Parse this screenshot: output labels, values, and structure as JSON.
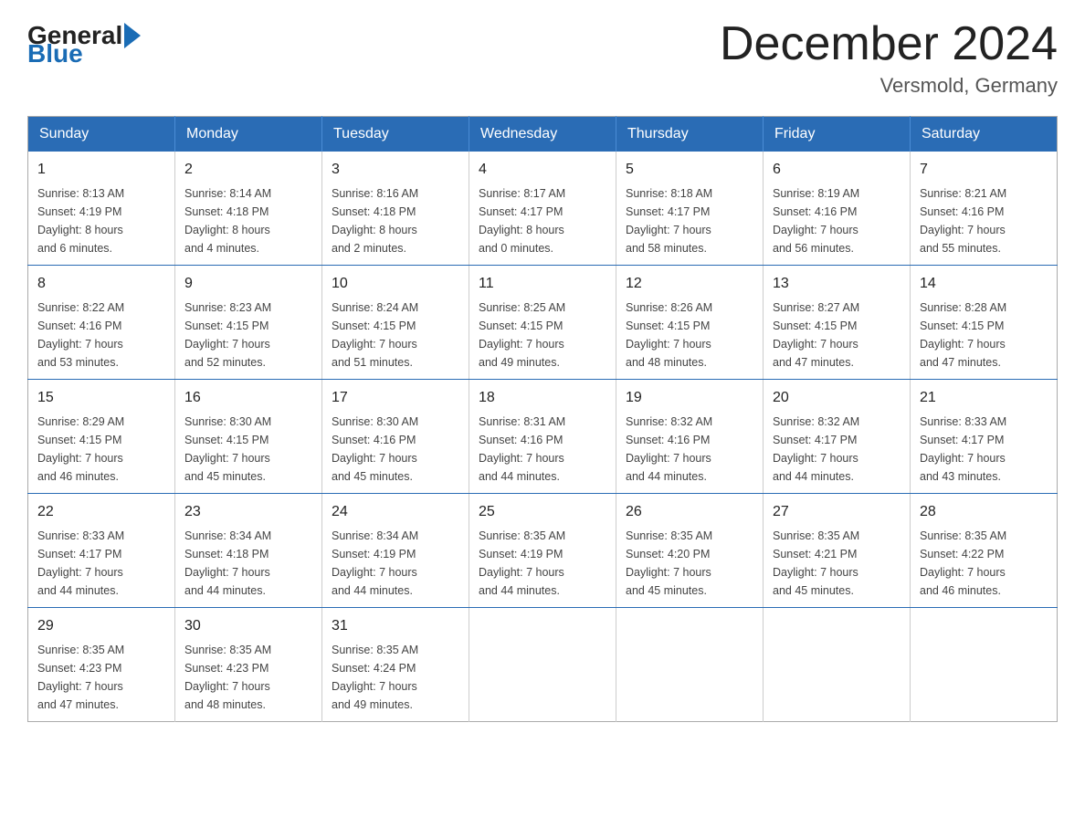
{
  "logo": {
    "general": "General",
    "blue": "Blue"
  },
  "header": {
    "month": "December 2024",
    "location": "Versmold, Germany"
  },
  "days_of_week": [
    "Sunday",
    "Monday",
    "Tuesday",
    "Wednesday",
    "Thursday",
    "Friday",
    "Saturday"
  ],
  "weeks": [
    [
      {
        "day": "1",
        "sunrise": "Sunrise: 8:13 AM",
        "sunset": "Sunset: 4:19 PM",
        "daylight": "Daylight: 8 hours and 6 minutes."
      },
      {
        "day": "2",
        "sunrise": "Sunrise: 8:14 AM",
        "sunset": "Sunset: 4:18 PM",
        "daylight": "Daylight: 8 hours and 4 minutes."
      },
      {
        "day": "3",
        "sunrise": "Sunrise: 8:16 AM",
        "sunset": "Sunset: 4:18 PM",
        "daylight": "Daylight: 8 hours and 2 minutes."
      },
      {
        "day": "4",
        "sunrise": "Sunrise: 8:17 AM",
        "sunset": "Sunset: 4:17 PM",
        "daylight": "Daylight: 8 hours and 0 minutes."
      },
      {
        "day": "5",
        "sunrise": "Sunrise: 8:18 AM",
        "sunset": "Sunset: 4:17 PM",
        "daylight": "Daylight: 7 hours and 58 minutes."
      },
      {
        "day": "6",
        "sunrise": "Sunrise: 8:19 AM",
        "sunset": "Sunset: 4:16 PM",
        "daylight": "Daylight: 7 hours and 56 minutes."
      },
      {
        "day": "7",
        "sunrise": "Sunrise: 8:21 AM",
        "sunset": "Sunset: 4:16 PM",
        "daylight": "Daylight: 7 hours and 55 minutes."
      }
    ],
    [
      {
        "day": "8",
        "sunrise": "Sunrise: 8:22 AM",
        "sunset": "Sunset: 4:16 PM",
        "daylight": "Daylight: 7 hours and 53 minutes."
      },
      {
        "day": "9",
        "sunrise": "Sunrise: 8:23 AM",
        "sunset": "Sunset: 4:15 PM",
        "daylight": "Daylight: 7 hours and 52 minutes."
      },
      {
        "day": "10",
        "sunrise": "Sunrise: 8:24 AM",
        "sunset": "Sunset: 4:15 PM",
        "daylight": "Daylight: 7 hours and 51 minutes."
      },
      {
        "day": "11",
        "sunrise": "Sunrise: 8:25 AM",
        "sunset": "Sunset: 4:15 PM",
        "daylight": "Daylight: 7 hours and 49 minutes."
      },
      {
        "day": "12",
        "sunrise": "Sunrise: 8:26 AM",
        "sunset": "Sunset: 4:15 PM",
        "daylight": "Daylight: 7 hours and 48 minutes."
      },
      {
        "day": "13",
        "sunrise": "Sunrise: 8:27 AM",
        "sunset": "Sunset: 4:15 PM",
        "daylight": "Daylight: 7 hours and 47 minutes."
      },
      {
        "day": "14",
        "sunrise": "Sunrise: 8:28 AM",
        "sunset": "Sunset: 4:15 PM",
        "daylight": "Daylight: 7 hours and 47 minutes."
      }
    ],
    [
      {
        "day": "15",
        "sunrise": "Sunrise: 8:29 AM",
        "sunset": "Sunset: 4:15 PM",
        "daylight": "Daylight: 7 hours and 46 minutes."
      },
      {
        "day": "16",
        "sunrise": "Sunrise: 8:30 AM",
        "sunset": "Sunset: 4:15 PM",
        "daylight": "Daylight: 7 hours and 45 minutes."
      },
      {
        "day": "17",
        "sunrise": "Sunrise: 8:30 AM",
        "sunset": "Sunset: 4:16 PM",
        "daylight": "Daylight: 7 hours and 45 minutes."
      },
      {
        "day": "18",
        "sunrise": "Sunrise: 8:31 AM",
        "sunset": "Sunset: 4:16 PM",
        "daylight": "Daylight: 7 hours and 44 minutes."
      },
      {
        "day": "19",
        "sunrise": "Sunrise: 8:32 AM",
        "sunset": "Sunset: 4:16 PM",
        "daylight": "Daylight: 7 hours and 44 minutes."
      },
      {
        "day": "20",
        "sunrise": "Sunrise: 8:32 AM",
        "sunset": "Sunset: 4:17 PM",
        "daylight": "Daylight: 7 hours and 44 minutes."
      },
      {
        "day": "21",
        "sunrise": "Sunrise: 8:33 AM",
        "sunset": "Sunset: 4:17 PM",
        "daylight": "Daylight: 7 hours and 43 minutes."
      }
    ],
    [
      {
        "day": "22",
        "sunrise": "Sunrise: 8:33 AM",
        "sunset": "Sunset: 4:17 PM",
        "daylight": "Daylight: 7 hours and 44 minutes."
      },
      {
        "day": "23",
        "sunrise": "Sunrise: 8:34 AM",
        "sunset": "Sunset: 4:18 PM",
        "daylight": "Daylight: 7 hours and 44 minutes."
      },
      {
        "day": "24",
        "sunrise": "Sunrise: 8:34 AM",
        "sunset": "Sunset: 4:19 PM",
        "daylight": "Daylight: 7 hours and 44 minutes."
      },
      {
        "day": "25",
        "sunrise": "Sunrise: 8:35 AM",
        "sunset": "Sunset: 4:19 PM",
        "daylight": "Daylight: 7 hours and 44 minutes."
      },
      {
        "day": "26",
        "sunrise": "Sunrise: 8:35 AM",
        "sunset": "Sunset: 4:20 PM",
        "daylight": "Daylight: 7 hours and 45 minutes."
      },
      {
        "day": "27",
        "sunrise": "Sunrise: 8:35 AM",
        "sunset": "Sunset: 4:21 PM",
        "daylight": "Daylight: 7 hours and 45 minutes."
      },
      {
        "day": "28",
        "sunrise": "Sunrise: 8:35 AM",
        "sunset": "Sunset: 4:22 PM",
        "daylight": "Daylight: 7 hours and 46 minutes."
      }
    ],
    [
      {
        "day": "29",
        "sunrise": "Sunrise: 8:35 AM",
        "sunset": "Sunset: 4:23 PM",
        "daylight": "Daylight: 7 hours and 47 minutes."
      },
      {
        "day": "30",
        "sunrise": "Sunrise: 8:35 AM",
        "sunset": "Sunset: 4:23 PM",
        "daylight": "Daylight: 7 hours and 48 minutes."
      },
      {
        "day": "31",
        "sunrise": "Sunrise: 8:35 AM",
        "sunset": "Sunset: 4:24 PM",
        "daylight": "Daylight: 7 hours and 49 minutes."
      },
      null,
      null,
      null,
      null
    ]
  ]
}
